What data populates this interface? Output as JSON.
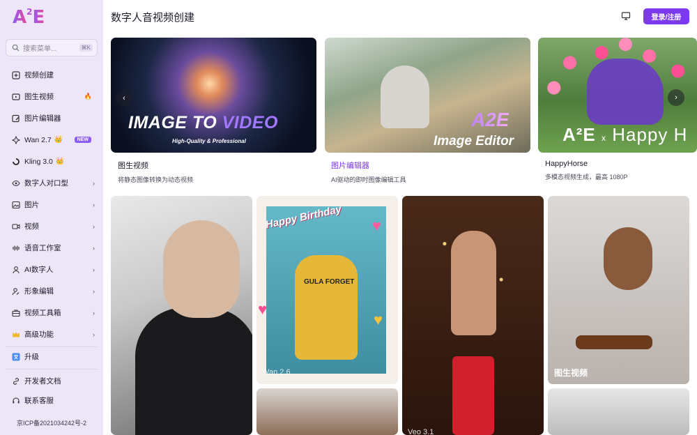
{
  "app": {
    "logo_main": "A",
    "logo_sup": "2",
    "logo_end": "E"
  },
  "search": {
    "placeholder": "搜索菜单...",
    "shortcut": "⌘K"
  },
  "sidebar": {
    "items": [
      {
        "label": "视频创建",
        "icon": "plus-square-icon"
      },
      {
        "label": "图生视频",
        "icon": "image-video-icon",
        "badge": "🔥"
      },
      {
        "label": "图片编辑器",
        "icon": "edit-image-icon"
      },
      {
        "label": "Wan 2.7",
        "icon": "wan-logo-icon",
        "crown": "👑",
        "badge": "NEW"
      },
      {
        "label": "Kling 3.0",
        "icon": "kling-logo-icon",
        "crown": "👑"
      },
      {
        "label": "数字人对口型",
        "icon": "eye-icon",
        "chevron": "›"
      },
      {
        "label": "图片",
        "icon": "image-icon",
        "chevron": "›"
      },
      {
        "label": "视频",
        "icon": "video-icon",
        "chevron": "›"
      },
      {
        "label": "语音工作室",
        "icon": "waveform-icon",
        "chevron": "›"
      },
      {
        "label": "AI数字人",
        "icon": "person-icon",
        "chevron": "›"
      },
      {
        "label": "形象编辑",
        "icon": "person-edit-icon",
        "chevron": "›"
      },
      {
        "label": "视频工具箱",
        "icon": "toolbox-icon",
        "chevron": "›"
      },
      {
        "label": "高级功能",
        "icon": "crown-icon",
        "chevron": "›"
      }
    ],
    "upgrade": {
      "label": "升级",
      "icon": "translate-icon"
    },
    "bottom": [
      {
        "label": "开发者文档",
        "icon": "link-icon"
      },
      {
        "label": "联系客服",
        "icon": "headset-icon"
      }
    ],
    "icp": "京ICP备2021034242号-2"
  },
  "header": {
    "title": "数字人音视频创建",
    "login": "登录/注册",
    "monitor_icon": "monitor-icon"
  },
  "carousel": {
    "cards": [
      {
        "headline_white": "IMAGE TO ",
        "headline_purple": "VIDEO",
        "sub": "High-Quality & Professional",
        "title": "图生视频",
        "desc": "将静态图像转换为动态视频"
      },
      {
        "logo": "A2E",
        "overlay": "Image Editor",
        "title": "图片编辑器",
        "desc": "AI驱动的即时图像编辑工具"
      },
      {
        "brand": "A²E",
        "brand_x": "x",
        "brand_2": "Happy H",
        "title": "HappyHorse",
        "desc": "多模态视频生成，最高 1080P"
      }
    ],
    "prev": "‹",
    "next": "›"
  },
  "gallery": {
    "tile2_text": "Happy Birthday",
    "tile2_shirt": "GULA FORGET",
    "tile2_watermark": "Wan 2.6",
    "tile3_watermark": "Veo 3.1",
    "tile4_label": "图生视频"
  }
}
